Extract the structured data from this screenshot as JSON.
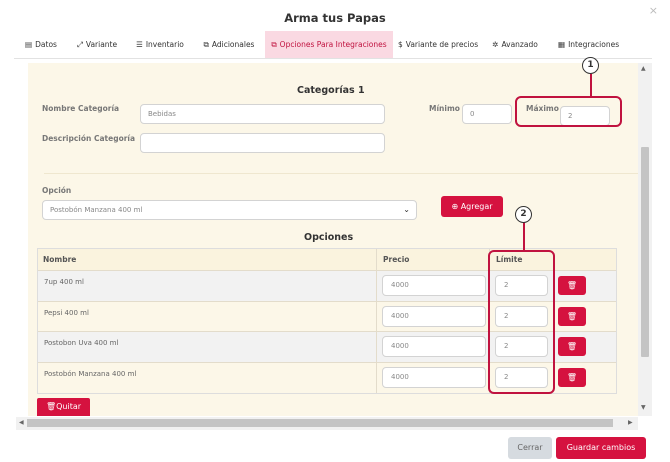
{
  "modal": {
    "title": "Arma tus Papas",
    "close_glyph": "×"
  },
  "tabs": [
    {
      "icon": "▤",
      "label": "Datos"
    },
    {
      "icon": "⤢",
      "label": "Variante"
    },
    {
      "icon": "☰",
      "label": "Inventario"
    },
    {
      "icon": "⧉",
      "label": "Adicionales"
    },
    {
      "icon": "⧉",
      "label": "Opciones Para Integraciones"
    },
    {
      "icon": "$",
      "label": "Variante de precios"
    },
    {
      "icon": "✲",
      "label": "Avanzado"
    },
    {
      "icon": "▦",
      "label": "Integraciones"
    }
  ],
  "active_tab": 4,
  "category": {
    "heading": "Categorías 1",
    "name_label": "Nombre Categoría",
    "name_value": "Bebidas",
    "min_label": "Mínimo",
    "min_value": "0",
    "max_label": "Máximo",
    "max_value": "2",
    "desc_label": "Descripción Categoría",
    "desc_value": ""
  },
  "option": {
    "label": "Opción",
    "selected": "Postobón Manzana 400 ml",
    "add_button": "Agregar",
    "add_icon": "⊕"
  },
  "options_table": {
    "heading": "Opciones",
    "columns": {
      "name": "Nombre",
      "price": "Precio",
      "limit": "Límite"
    },
    "rows": [
      {
        "name": "7up 400 ml",
        "price": "4000",
        "limit": "2"
      },
      {
        "name": "Pepsi 400 ml",
        "price": "4000",
        "limit": "2"
      },
      {
        "name": "Postobon Uva 400 ml",
        "price": "4000",
        "limit": "2"
      },
      {
        "name": "Postobón Manzana 400 ml",
        "price": "4000",
        "limit": "2"
      }
    ],
    "delete_icon": "🗑"
  },
  "remove_button": {
    "icon": "🗑",
    "label": "Quitar"
  },
  "callouts": {
    "one": "1",
    "two": "2"
  },
  "footer": {
    "cancel": "Cerrar",
    "save": "Guardar cambios"
  },
  "colors": {
    "accent": "#d5123f",
    "tab_active_bg": "#fad9e2",
    "pane_bg": "#fcf7e8"
  }
}
